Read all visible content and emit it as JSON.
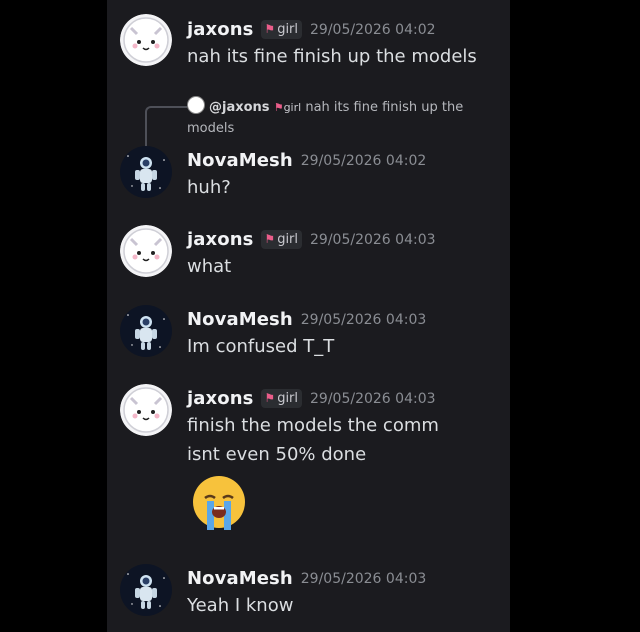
{
  "messages": [
    {
      "user": "jaxons",
      "tag": "girl",
      "time": "29/05/2026 04:02",
      "text": "nah its fine finish up the models"
    },
    {
      "user": "NovaMesh",
      "time": "29/05/2026 04:02",
      "text": "huh?",
      "reply": {
        "mention": "@jaxons",
        "tag": "girl",
        "text": "nah its fine finish up the models"
      }
    },
    {
      "user": "jaxons",
      "tag": "girl",
      "time": "29/05/2026 04:03",
      "text": "what"
    },
    {
      "user": "NovaMesh",
      "time": "29/05/2026 04:03",
      "text": "Im confused T_T"
    },
    {
      "user": "jaxons",
      "tag": "girl",
      "time": "29/05/2026 04:03",
      "text": "finish the models the comm isnt even 50% done",
      "emoji": "loudly-crying-face"
    },
    {
      "user": "NovaMesh",
      "time": "29/05/2026 04:03",
      "text": "Yeah I know"
    }
  ],
  "icons": {
    "jump_to_bottom": "arrow-down-icon",
    "tag_icon": "cat-icon"
  },
  "colors": {
    "background": "#1b1b1f",
    "tag_icon": "#ea5d8a",
    "timestamp": "#8a8d93"
  }
}
